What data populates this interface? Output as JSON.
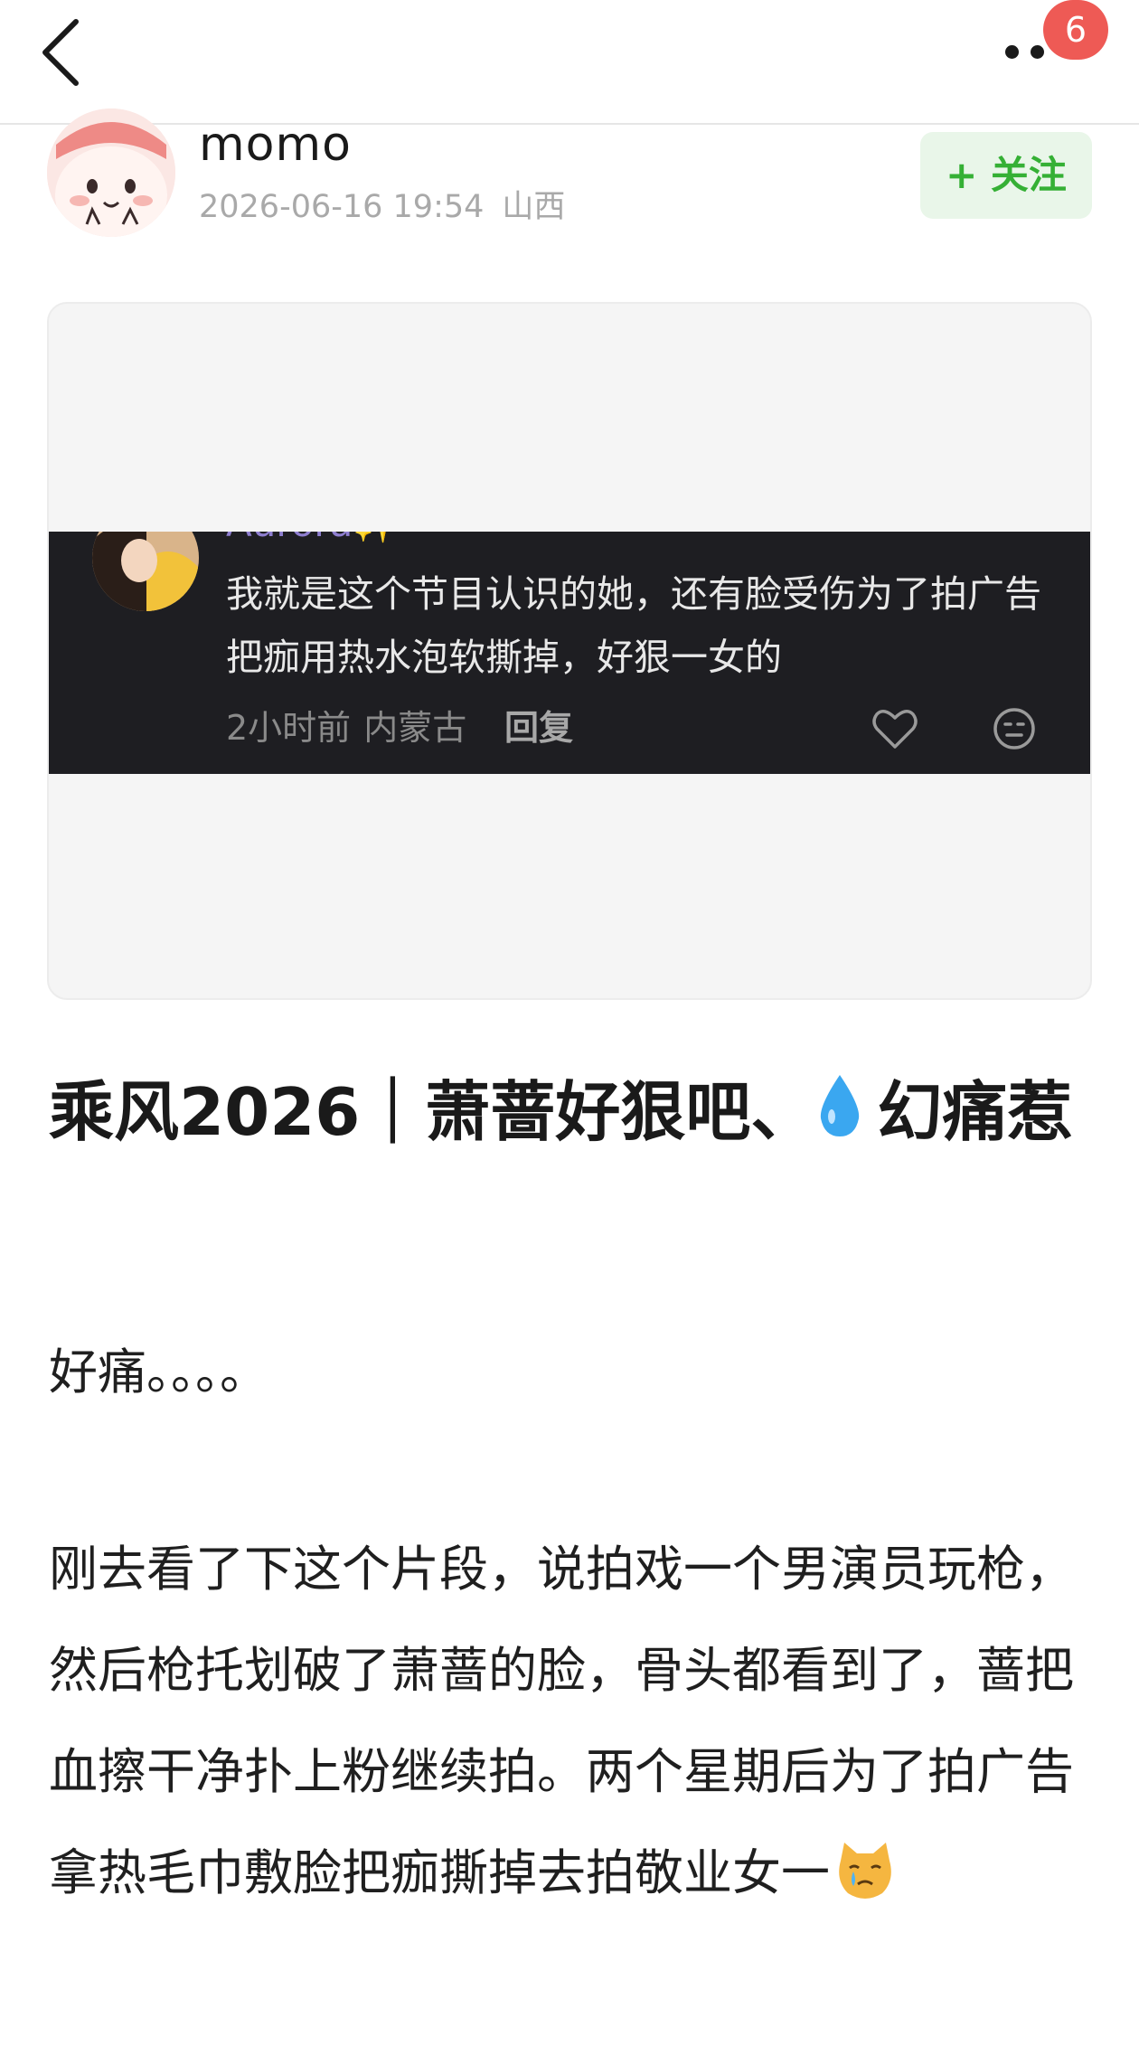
{
  "nav": {
    "badge_count": "6",
    "back_icon": "chevron-left-icon",
    "more_icon": "more-dots-icon"
  },
  "author": {
    "name": "momo",
    "datetime": "2026-06-16 19:54",
    "location": "山西",
    "follow_label": "+ 关注"
  },
  "embedded_comment": {
    "username": "Aurora✨",
    "text": "我就是这个节目认识的她，还有脸受伤为了拍广告把痂用热水泡软撕掉，好狠一女的",
    "time": "2小时前",
    "location": "内蒙古",
    "reply_label": "回复",
    "like_icon": "heart-icon",
    "emoji_icon": "emoji-face-icon"
  },
  "post": {
    "title_part1": "乘风2026｜萧蔷好狠吧、",
    "title_part2": "幻痛惹",
    "title_emoji": "water-drop-icon",
    "paragraph_1": "好痛。。。。",
    "paragraph_2": "刚去看了下这个片段，说拍戏一个男演员玩枪，然后枪托划破了萧蔷的脸，骨头都看到了，蔷把血擦干净扑上粉继续拍。两个星期后为了拍广告拿热毛巾敷脸把痂撕掉去拍敬业女一",
    "paragraph_2_emoji": "crying-cat-icon"
  },
  "colors": {
    "follow_text": "#35b035",
    "follow_bg": "#e9f6e9",
    "badge": "#ee5a55",
    "dark_strip": "#1e1e22"
  }
}
